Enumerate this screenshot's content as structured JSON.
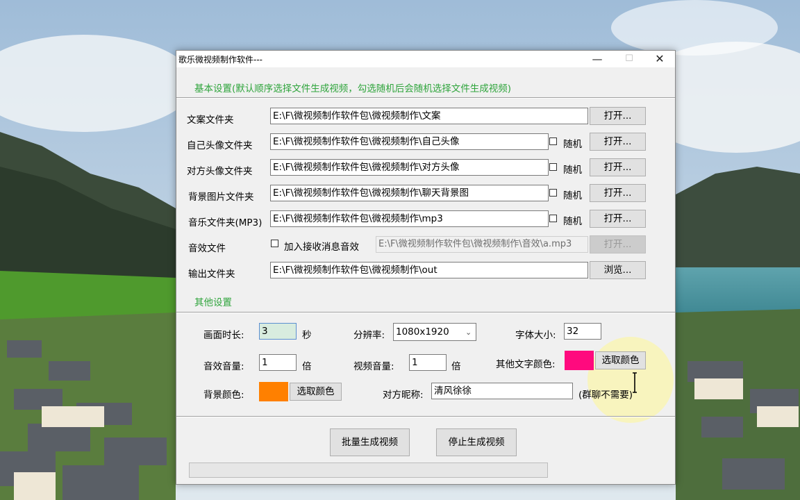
{
  "window": {
    "title": "歌乐微视频制作软件---",
    "controls": {
      "minimize": "—",
      "maximize": "☐",
      "close": "✕"
    }
  },
  "basic": {
    "heading": "基本设置(默认顺序选择文件生成视频，勾选随机后会随机选择文件生成视频)",
    "rows": [
      {
        "label": "文案文件夹",
        "path": "E:\\F\\微视频制作软件包\\微视频制作\\文案",
        "random": null,
        "button": "打开..."
      },
      {
        "label": "自己头像文件夹",
        "path": "E:\\F\\微视频制作软件包\\微视频制作\\自己头像",
        "random": "随机",
        "button": "打开..."
      },
      {
        "label": "对方头像文件夹",
        "path": "E:\\F\\微视频制作软件包\\微视频制作\\对方头像",
        "random": "随机",
        "button": "打开..."
      },
      {
        "label": "背景图片文件夹",
        "path": "E:\\F\\微视频制作软件包\\微视频制作\\聊天背景图",
        "random": "随机",
        "button": "打开..."
      },
      {
        "label": "音乐文件夹(MP3)",
        "path": "E:\\F\\微视频制作软件包\\微视频制作\\mp3",
        "random": "随机",
        "button": "打开..."
      }
    ],
    "sound": {
      "label": "音效文件",
      "checkbox": "加入接收消息音效",
      "path": "E:\\F\\微视频制作软件包\\微视频制作\\音效\\a.mp3",
      "button": "打开..."
    },
    "output": {
      "label": "输出文件夹",
      "path": "E:\\F\\微视频制作软件包\\微视频制作\\out",
      "button": "浏览..."
    }
  },
  "other": {
    "heading": "其他设置",
    "duration_label": "画面时长:",
    "duration_value": "3",
    "duration_unit": "秒",
    "resolution_label": "分辨率:",
    "resolution_value": "1080x1920",
    "font_size_label": "字体大小:",
    "font_size_value": "32",
    "sfx_volume_label": "音效音量:",
    "sfx_volume_value": "1",
    "sfx_volume_unit": "倍",
    "video_volume_label": "视频音量:",
    "video_volume_value": "1",
    "video_volume_unit": "倍",
    "text_color_label": "其他文字颜色:",
    "text_color": "#ff0a7e",
    "text_color_button": "选取颜色",
    "bg_color_label": "背景颜色:",
    "bg_color": "#ff8000",
    "bg_color_button": "选取颜色",
    "nickname_label": "对方昵称:",
    "nickname_value": "清风徐徐",
    "nickname_hint": "(群聊不需要)"
  },
  "actions": {
    "generate": "批量生成视频",
    "stop": "停止生成视频"
  },
  "progress": 0,
  "colors": {
    "section_green": "#2ea43b",
    "window_bg": "#f0f0f0"
  },
  "icons": {
    "dropdown": "chevron-down-icon"
  }
}
